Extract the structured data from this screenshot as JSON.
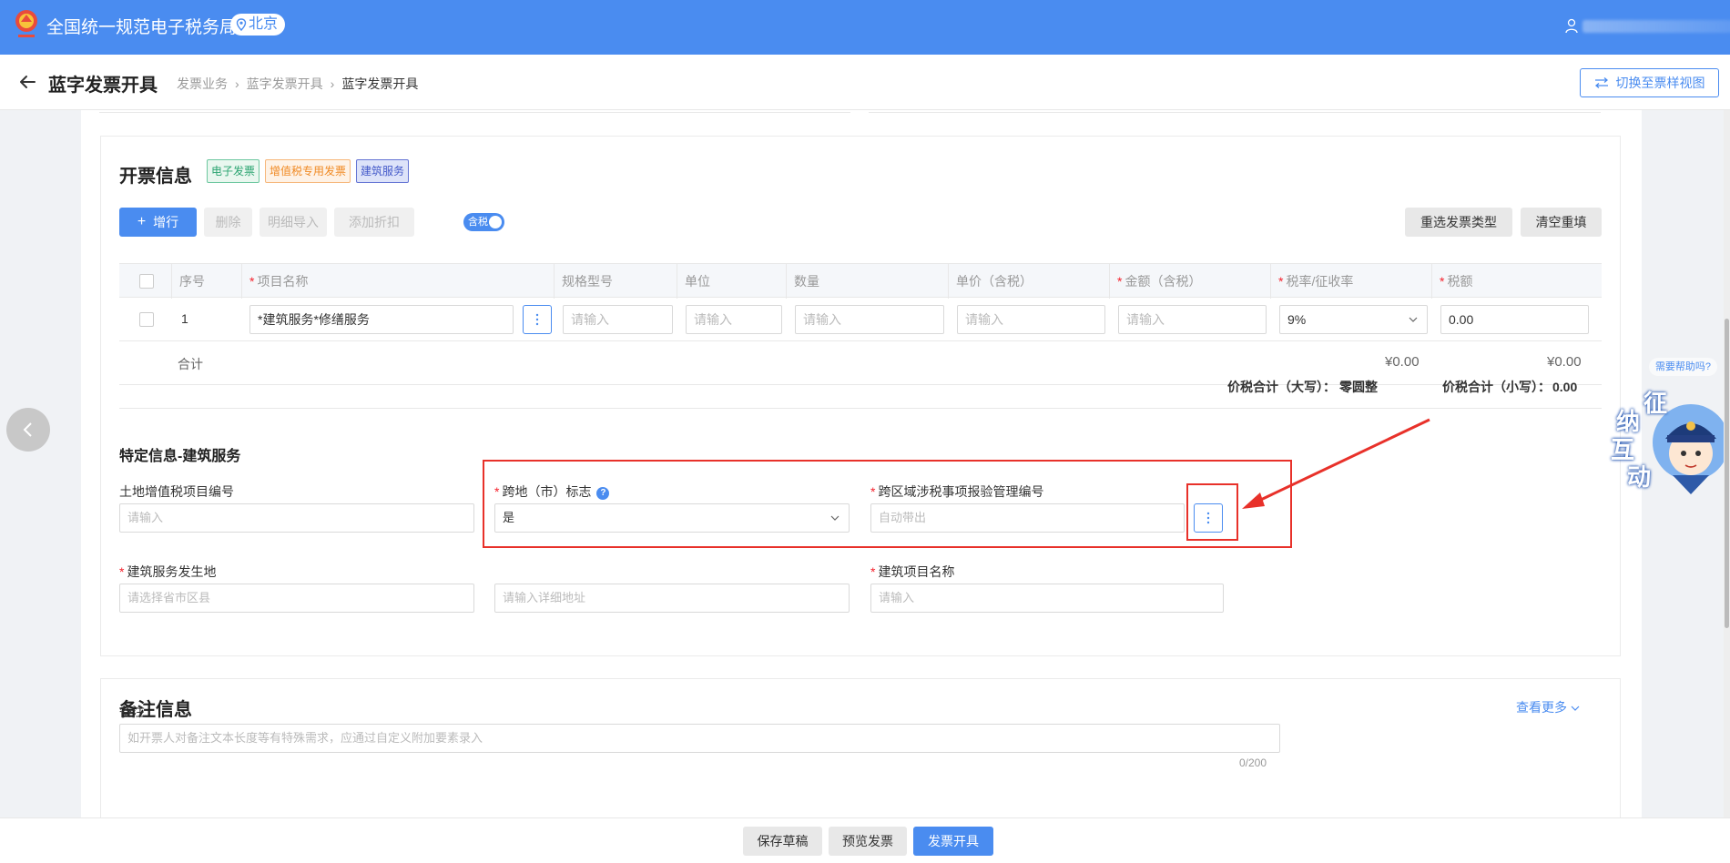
{
  "topbar": {
    "site_title": "全国统一规范电子税务局",
    "region": "北京"
  },
  "header": {
    "title": "蓝字发票开具",
    "breadcrumb": [
      "发票业务",
      "蓝字发票开具",
      "蓝字发票开具"
    ],
    "switch_view": "切换至票样视图"
  },
  "invoice": {
    "section_title": "开票信息",
    "tags": [
      "电子发票",
      "增值税专用发票",
      "建筑服务"
    ],
    "toolbar": {
      "add_row": "增行",
      "delete": "删除",
      "detail_import": "明细导入",
      "add_discount": "添加折扣",
      "tax_toggle": "含税",
      "reselect_type": "重选发票类型",
      "clear_refill": "清空重填"
    },
    "columns": [
      "序号",
      "项目名称",
      "规格型号",
      "单位",
      "数量",
      "单价（含税）",
      "金额（含税）",
      "税率/征收率",
      "税额"
    ],
    "row": {
      "index": "1",
      "item_name": "*建筑服务*修缮服务",
      "spec_placeholder": "请输入",
      "unit_placeholder": "请输入",
      "qty_placeholder": "请输入",
      "price_placeholder": "请输入",
      "amount_placeholder": "请输入",
      "tax_rate": "9%",
      "tax_amount": "0.00"
    },
    "summary": {
      "label": "合计",
      "amount": "¥0.00",
      "tax": "¥0.00"
    },
    "total_upper_label": "价税合计（大写）：",
    "total_upper_value": "零圆整",
    "total_lower_label": "价税合计（小写）：",
    "total_lower_value": "0.00"
  },
  "special": {
    "title": "特定信息-建筑服务",
    "land_vat_label": "土地增值税项目编号",
    "land_vat_placeholder": "请输入",
    "cross_region_label": "跨地（市）标志",
    "cross_region_value": "是",
    "cross_region_mgmt_label": "跨区域涉税事项报验管理编号",
    "cross_region_mgmt_placeholder": "自动带出",
    "service_location_label": "建筑服务发生地",
    "location_placeholder": "请选择省市区县",
    "address_placeholder": "请输入详细地址",
    "project_name_label": "建筑项目名称",
    "project_name_placeholder": "请输入"
  },
  "remarks": {
    "title": "备注信息",
    "view_more": "查看更多",
    "label": "备注",
    "placeholder": "如开票人对备注文本长度等有特殊需求，应通过自定义附加要素录入",
    "counter": "0/200"
  },
  "side": {
    "help_link": "需要帮助吗?",
    "mascot_text": [
      "征",
      "纳",
      "互",
      "动"
    ]
  },
  "footer": {
    "save_draft": "保存草稿",
    "preview": "预览发票",
    "issue": "发票开具"
  },
  "colors": {
    "primary": "#4a8cf0",
    "required": "#f5222d",
    "annotation": "#e8312a"
  }
}
